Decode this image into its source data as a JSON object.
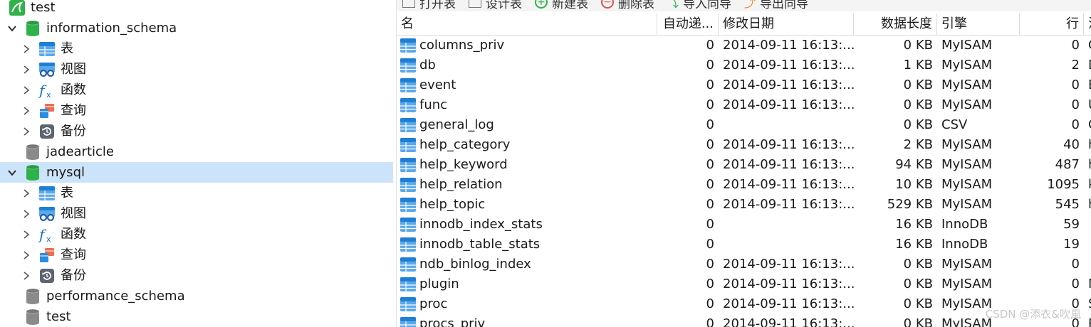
{
  "tree": {
    "connection": "test",
    "databases": [
      {
        "name": "information_schema",
        "expanded": true,
        "children": [
          "表",
          "视图",
          "函数",
          "查询",
          "备份"
        ]
      },
      {
        "name": "jadearticle",
        "expanded": false,
        "children": []
      },
      {
        "name": "mysql",
        "expanded": true,
        "selected": true,
        "children": [
          "表",
          "视图",
          "函数",
          "查询",
          "备份"
        ]
      },
      {
        "name": "performance_schema",
        "expanded": false,
        "children": []
      },
      {
        "name": "test",
        "expanded": false,
        "children": []
      }
    ]
  },
  "toolbar": {
    "buttons": [
      "打开表",
      "设计表",
      "新建表",
      "删除表",
      "导入向导",
      "导出向导"
    ]
  },
  "grid": {
    "columns": [
      "名",
      "自动递...",
      "修改日期",
      "数据长度",
      "引擎",
      "行",
      "注"
    ],
    "rows": [
      {
        "name": "columns_priv",
        "auto": "0",
        "modified": "2014-09-11 16:13:...",
        "size": "0 KB",
        "engine": "MyISAM",
        "rows": "0",
        "comment": "C"
      },
      {
        "name": "db",
        "auto": "0",
        "modified": "2014-09-11 16:13:...",
        "size": "1 KB",
        "engine": "MyISAM",
        "rows": "2",
        "comment": "D"
      },
      {
        "name": "event",
        "auto": "0",
        "modified": "2014-09-11 16:13:...",
        "size": "0 KB",
        "engine": "MyISAM",
        "rows": "0",
        "comment": "E"
      },
      {
        "name": "func",
        "auto": "0",
        "modified": "2014-09-11 16:13:...",
        "size": "0 KB",
        "engine": "MyISAM",
        "rows": "0",
        "comment": "U"
      },
      {
        "name": "general_log",
        "auto": "0",
        "modified": "",
        "size": "0 KB",
        "engine": "CSV",
        "rows": "0",
        "comment": "G"
      },
      {
        "name": "help_category",
        "auto": "0",
        "modified": "2014-09-11 16:13:...",
        "size": "2 KB",
        "engine": "MyISAM",
        "rows": "40",
        "comment": "h"
      },
      {
        "name": "help_keyword",
        "auto": "0",
        "modified": "2014-09-11 16:13:...",
        "size": "94 KB",
        "engine": "MyISAM",
        "rows": "487",
        "comment": "h"
      },
      {
        "name": "help_relation",
        "auto": "0",
        "modified": "2014-09-11 16:13:...",
        "size": "10 KB",
        "engine": "MyISAM",
        "rows": "1095",
        "comment": "k"
      },
      {
        "name": "help_topic",
        "auto": "0",
        "modified": "2014-09-11 16:13:...",
        "size": "529 KB",
        "engine": "MyISAM",
        "rows": "545",
        "comment": "h"
      },
      {
        "name": "innodb_index_stats",
        "auto": "0",
        "modified": "",
        "size": "16 KB",
        "engine": "InnoDB",
        "rows": "59",
        "comment": ""
      },
      {
        "name": "innodb_table_stats",
        "auto": "0",
        "modified": "",
        "size": "16 KB",
        "engine": "InnoDB",
        "rows": "19",
        "comment": ""
      },
      {
        "name": "ndb_binlog_index",
        "auto": "0",
        "modified": "2014-09-11 16:13:...",
        "size": "0 KB",
        "engine": "MyISAM",
        "rows": "0",
        "comment": ""
      },
      {
        "name": "plugin",
        "auto": "0",
        "modified": "2014-09-11 16:13:...",
        "size": "0 KB",
        "engine": "MyISAM",
        "rows": "0",
        "comment": "M"
      },
      {
        "name": "proc",
        "auto": "0",
        "modified": "2014-09-11 16:13:...",
        "size": "0 KB",
        "engine": "MyISAM",
        "rows": "0",
        "comment": "S"
      },
      {
        "name": "procs_priv",
        "auto": "0",
        "modified": "2014-09-11 16:13:...",
        "size": "0 KB",
        "engine": "MyISAM",
        "rows": "0",
        "comment": "P"
      }
    ]
  },
  "watermark": "CSDN @添衣&吹風",
  "colors": {
    "selection": "#cce4fa",
    "db_active": "#2fb24a",
    "db_inactive": "#8a8a8a",
    "table_icon": "#2b8be0",
    "function_icon": "#1a73c9"
  }
}
